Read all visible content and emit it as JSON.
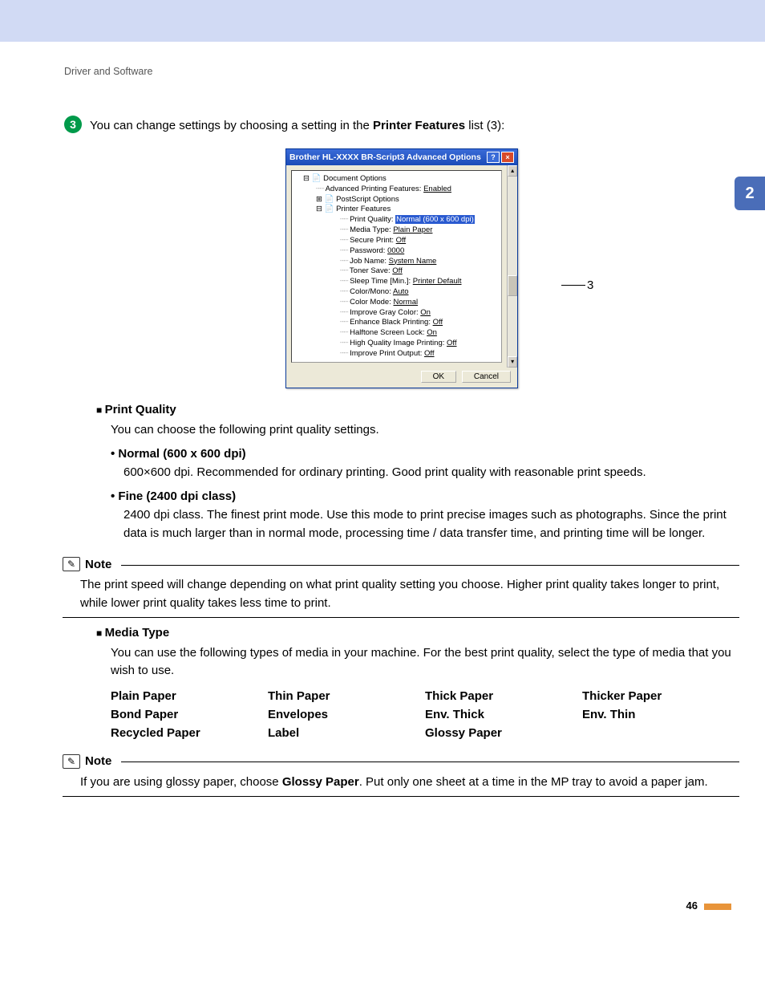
{
  "breadcrumb": "Driver and Software",
  "chapter": "2",
  "step": {
    "num": "3",
    "text_a": "You can change settings by choosing a setting in the ",
    "text_b": "Printer Features",
    "text_c": " list (3):"
  },
  "dialog": {
    "title": "Brother HL-XXXX BR-Script3 Advanced Options",
    "root": "Document Options",
    "adv": "Advanced Printing Features:",
    "adv_v": "Enabled",
    "ps": "PostScript Options",
    "pf": "Printer Features",
    "items": [
      {
        "k": "Print Quality:",
        "v": "Normal (600 x 600 dpi)",
        "sel": true
      },
      {
        "k": "Media Type:",
        "v": "Plain Paper"
      },
      {
        "k": "Secure Print:",
        "v": "Off"
      },
      {
        "k": "Password:",
        "v": "0000"
      },
      {
        "k": "Job Name:",
        "v": "System Name"
      },
      {
        "k": "Toner Save:",
        "v": "Off"
      },
      {
        "k": "Sleep Time [Min.]:",
        "v": "Printer Default"
      },
      {
        "k": "Color/Mono:",
        "v": "Auto"
      },
      {
        "k": "Color Mode:",
        "v": "Normal"
      },
      {
        "k": "Improve Gray Color:",
        "v": "On"
      },
      {
        "k": "Enhance Black Printing:",
        "v": "Off"
      },
      {
        "k": "Halftone Screen Lock:",
        "v": "On"
      },
      {
        "k": "High Quality Image Printing:",
        "v": "Off"
      },
      {
        "k": "Improve Print Output:",
        "v": "Off"
      }
    ],
    "ok": "OK",
    "cancel": "Cancel",
    "callout": "3"
  },
  "pq": {
    "head": "Print Quality",
    "intro": "You can choose the following print quality settings.",
    "opt1": "Normal (600 x 600 dpi)",
    "opt1_body": "600×600 dpi. Recommended for ordinary printing. Good print quality with reasonable print speeds.",
    "opt2": "Fine (2400 dpi class)",
    "opt2_body": "2400 dpi class. The finest print mode. Use this mode to print precise images such as photographs. Since the print data is much larger than in normal mode, processing time / data transfer time, and printing time will be longer."
  },
  "note1": {
    "label": "Note",
    "body": "The print speed will change depending on what print quality setting you choose. Higher print quality takes longer to print, while lower print quality takes less time to print."
  },
  "mt": {
    "head": "Media Type",
    "intro": "You can use the following types of media in your machine. For the best print quality, select the type of media that you wish to use.",
    "types": [
      "Plain Paper",
      "Thin Paper",
      "Thick Paper",
      "Thicker Paper",
      "Bond Paper",
      "Envelopes",
      "Env. Thick",
      "Env. Thin",
      "Recycled Paper",
      "Label",
      "Glossy Paper"
    ]
  },
  "note2": {
    "label": "Note",
    "a": "If you are using glossy paper, choose ",
    "b": "Glossy Paper",
    "c": ". Put only one sheet at a time in the MP tray to avoid a paper jam."
  },
  "page_num": "46"
}
